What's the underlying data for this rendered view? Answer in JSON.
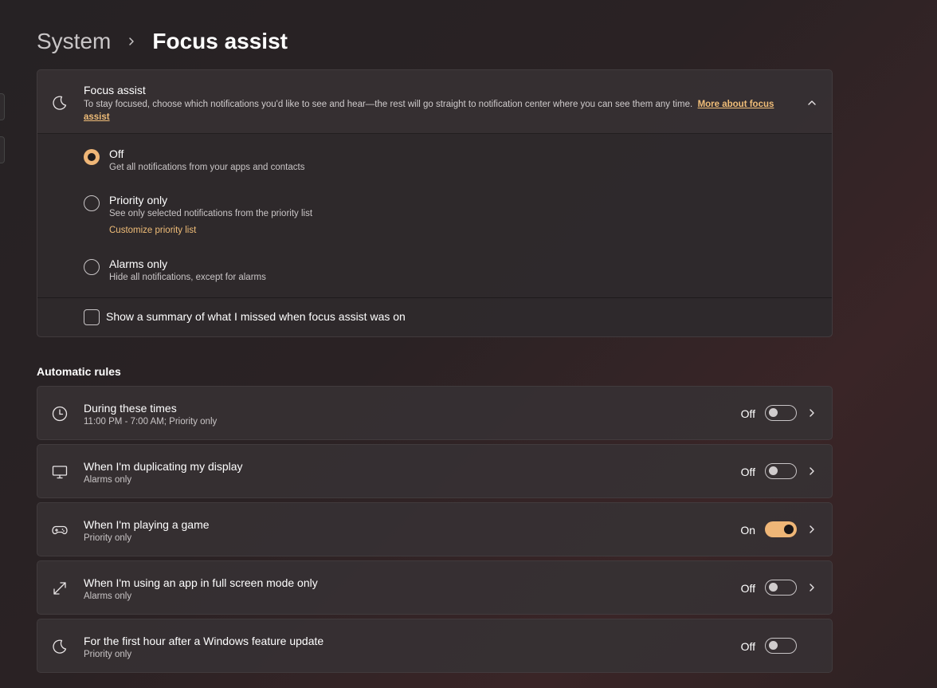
{
  "breadcrumb": {
    "parent": "System",
    "current": "Focus assist"
  },
  "focus_assist": {
    "icon": "moon-icon",
    "title": "Focus assist",
    "description": "To stay focused, choose which notifications you'd like to see and hear—the rest will go straight to notification center where you can see them any time.",
    "link": "More about focus assist",
    "options": [
      {
        "label": "Off",
        "sub": "Get all notifications from your apps and contacts",
        "selected": true
      },
      {
        "label": "Priority only",
        "sub": "See only selected notifications from the priority list",
        "link": "Customize priority list",
        "selected": false
      },
      {
        "label": "Alarms only",
        "sub": "Hide all notifications, except for alarms",
        "selected": false
      }
    ],
    "summary_checkbox": {
      "label": "Show a summary of what I missed when focus assist was on",
      "checked": false
    }
  },
  "automatic_rules": {
    "title": "Automatic rules",
    "items": [
      {
        "icon": "clock-icon",
        "title": "During these times",
        "sub": "11:00 PM - 7:00 AM; Priority only",
        "state": "Off",
        "on": false,
        "chevron": true
      },
      {
        "icon": "monitor-icon",
        "title": "When I'm duplicating my display",
        "sub": "Alarms only",
        "state": "Off",
        "on": false,
        "chevron": true
      },
      {
        "icon": "gamepad-icon",
        "title": "When I'm playing a game",
        "sub": "Priority only",
        "state": "On",
        "on": true,
        "chevron": true
      },
      {
        "icon": "fullscreen-icon",
        "title": "When I'm using an app in full screen mode only",
        "sub": "Alarms only",
        "state": "Off",
        "on": false,
        "chevron": true
      },
      {
        "icon": "moon-icon",
        "title": "For the first hour after a Windows feature update",
        "sub": "Priority only",
        "state": "Off",
        "on": false,
        "chevron": false
      }
    ]
  },
  "colors": {
    "accent": "#efb677",
    "link": "#f0bd78",
    "card": "#363133"
  }
}
